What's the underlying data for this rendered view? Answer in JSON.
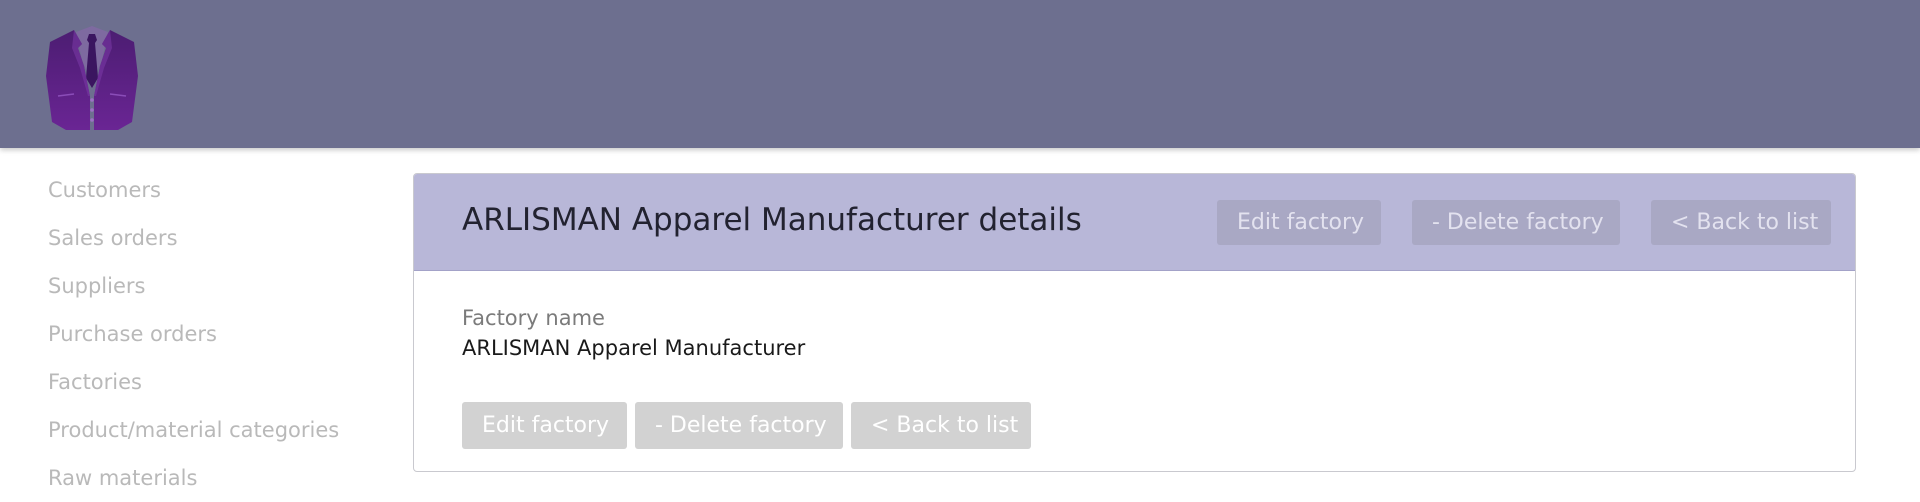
{
  "header": {
    "logo_icon": "suit-jacket-icon",
    "background_color": "#6d6f8f"
  },
  "sidebar": {
    "items": [
      {
        "label": "Customers"
      },
      {
        "label": "Sales orders"
      },
      {
        "label": "Suppliers"
      },
      {
        "label": "Purchase orders"
      },
      {
        "label": "Factories"
      },
      {
        "label": "Product/material categories"
      },
      {
        "label": "Raw materials"
      }
    ]
  },
  "panel": {
    "title": "ARLISMAN Apparel Manufacturer details",
    "header_buttons": {
      "edit": "Edit factory",
      "delete": "- Delete factory",
      "back": "< Back to list"
    },
    "field": {
      "label": "Factory name",
      "value": "ARLISMAN Apparel Manufacturer"
    },
    "body_buttons": {
      "edit": "Edit factory",
      "delete": "- Delete factory",
      "back": "< Back to list"
    },
    "header_color": "#b8b7d8"
  }
}
